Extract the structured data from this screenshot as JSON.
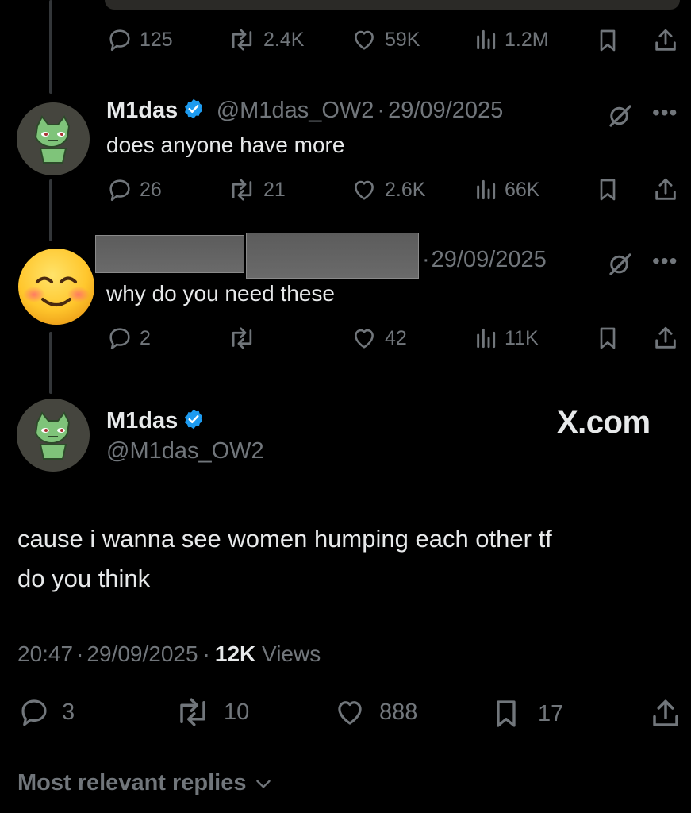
{
  "tweet_top": {
    "replies": "125",
    "reposts": "2.4K",
    "likes": "59K",
    "views": "1.2M"
  },
  "reply1": {
    "name": "M1das",
    "handle": "@M1das_OW2",
    "sep": "·",
    "date": "29/09/2025",
    "text": "does anyone have more",
    "replies": "26",
    "reposts": "21",
    "likes": "2.6K",
    "views": "66K"
  },
  "reply2": {
    "sep": "·",
    "date": "29/09/2025",
    "text": "why do you need these",
    "replies": "2",
    "reposts": "",
    "likes": "42",
    "views": "11K"
  },
  "main": {
    "name": "M1das",
    "handle": "@M1das_OW2",
    "watermark": "X.com",
    "text_line1": "cause i wanna see women humping each other tf",
    "text_line2": "do you think",
    "time": "20:47",
    "sep1": "·",
    "date": "29/09/2025",
    "sep2": "·",
    "views_count": "12K",
    "views_label": "Views",
    "replies": "3",
    "reposts": "10",
    "likes": "888",
    "bookmarks": "17"
  },
  "footer": {
    "sort_label": "Most relevant replies"
  },
  "colors": {
    "background": "#000000",
    "text": "#e7e9ea",
    "muted": "#71767b",
    "verified": "#1d9bf0",
    "thread_line": "#333639"
  }
}
